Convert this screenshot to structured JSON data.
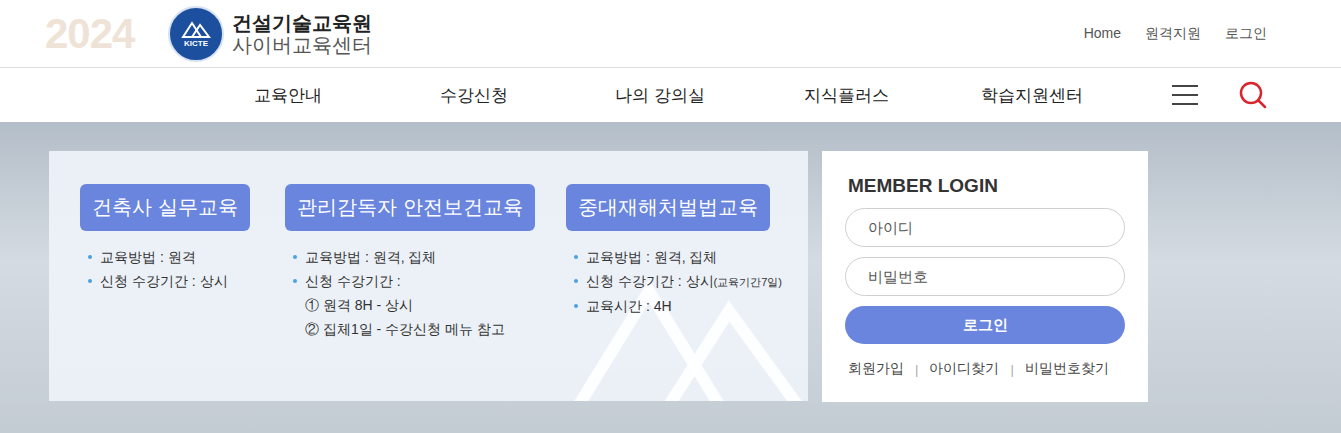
{
  "header": {
    "watermark": "2024",
    "logo": {
      "badge": "KICTE",
      "title": "건설기술교육원",
      "subtitle": "사이버교육센터"
    },
    "links": [
      "Home",
      "원격지원",
      "로그인"
    ]
  },
  "nav": {
    "items": [
      "교육안내",
      "수강신청",
      "나의 강의실",
      "지식플러스",
      "학습지원센터"
    ]
  },
  "courses": [
    {
      "title": "건축사 실무교육",
      "details": [
        {
          "kind": "bullet",
          "text": "교육방법 : 원격"
        },
        {
          "kind": "bullet",
          "text": "신청 수강기간 : 상시"
        }
      ]
    },
    {
      "title": "관리감독자 안전보건교육",
      "details": [
        {
          "kind": "bullet",
          "text": "교육방법 : 원격, 집체"
        },
        {
          "kind": "bullet",
          "text": "신청 수강기간 :"
        },
        {
          "kind": "sub",
          "text": "① 원격 8H - 상시"
        },
        {
          "kind": "sub",
          "text": "② 집체1일 - 수강신청 메뉴 참고"
        }
      ]
    },
    {
      "title": "중대재해처벌법교육",
      "details": [
        {
          "kind": "bullet",
          "text": "교육방법 : 원격, 집체"
        },
        {
          "kind": "bullet",
          "text": "신청 수강기간 : 상시",
          "note": "(교육기간7일)"
        },
        {
          "kind": "bullet",
          "text": "교육시간 : 4H"
        }
      ]
    }
  ],
  "login": {
    "title": "MEMBER LOGIN",
    "fields": [
      {
        "placeholder": "아이디",
        "type": "text"
      },
      {
        "placeholder": "비밀번호",
        "type": "password"
      }
    ],
    "button": "로그인",
    "links": [
      "회원가입",
      "아이디찾기",
      "비밀번호찾기"
    ],
    "separator": "|"
  }
}
